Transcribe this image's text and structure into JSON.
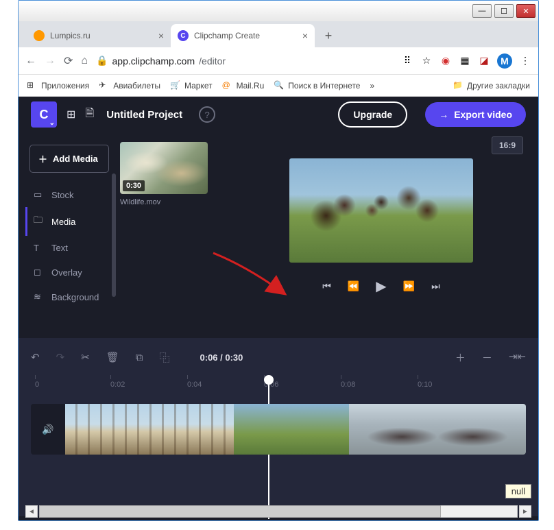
{
  "browser": {
    "tabs": [
      {
        "title": "Lumpics.ru"
      },
      {
        "title": "Clipchamp Create"
      }
    ],
    "url_host": "app.clipchamp.com",
    "url_path": "/editor"
  },
  "bookmarks": {
    "apps": "Приложения",
    "flights": "Авиабилеты",
    "market": "Маркет",
    "mail": "Mail.Ru",
    "search": "Поиск в Интернете",
    "more": "»",
    "other": "Другие закладки"
  },
  "app": {
    "logo": "C",
    "project_title": "Untitled Project",
    "upgrade": "Upgrade",
    "export": "Export video",
    "aspect": "16:9"
  },
  "sidebar": {
    "add_media": "Add Media",
    "items": [
      "Stock",
      "Media",
      "Text",
      "Overlay",
      "Background"
    ]
  },
  "media": {
    "clip_duration": "0:30",
    "clip_name": "Wildlife.mov"
  },
  "playback": {
    "time": "0:06 / 0:30"
  },
  "ruler": {
    "t0": "0",
    "t1": "0:02",
    "t2": "0:04",
    "t3": "0:06",
    "t4": "0:08",
    "t5": "0:10"
  },
  "tooltip": "null"
}
